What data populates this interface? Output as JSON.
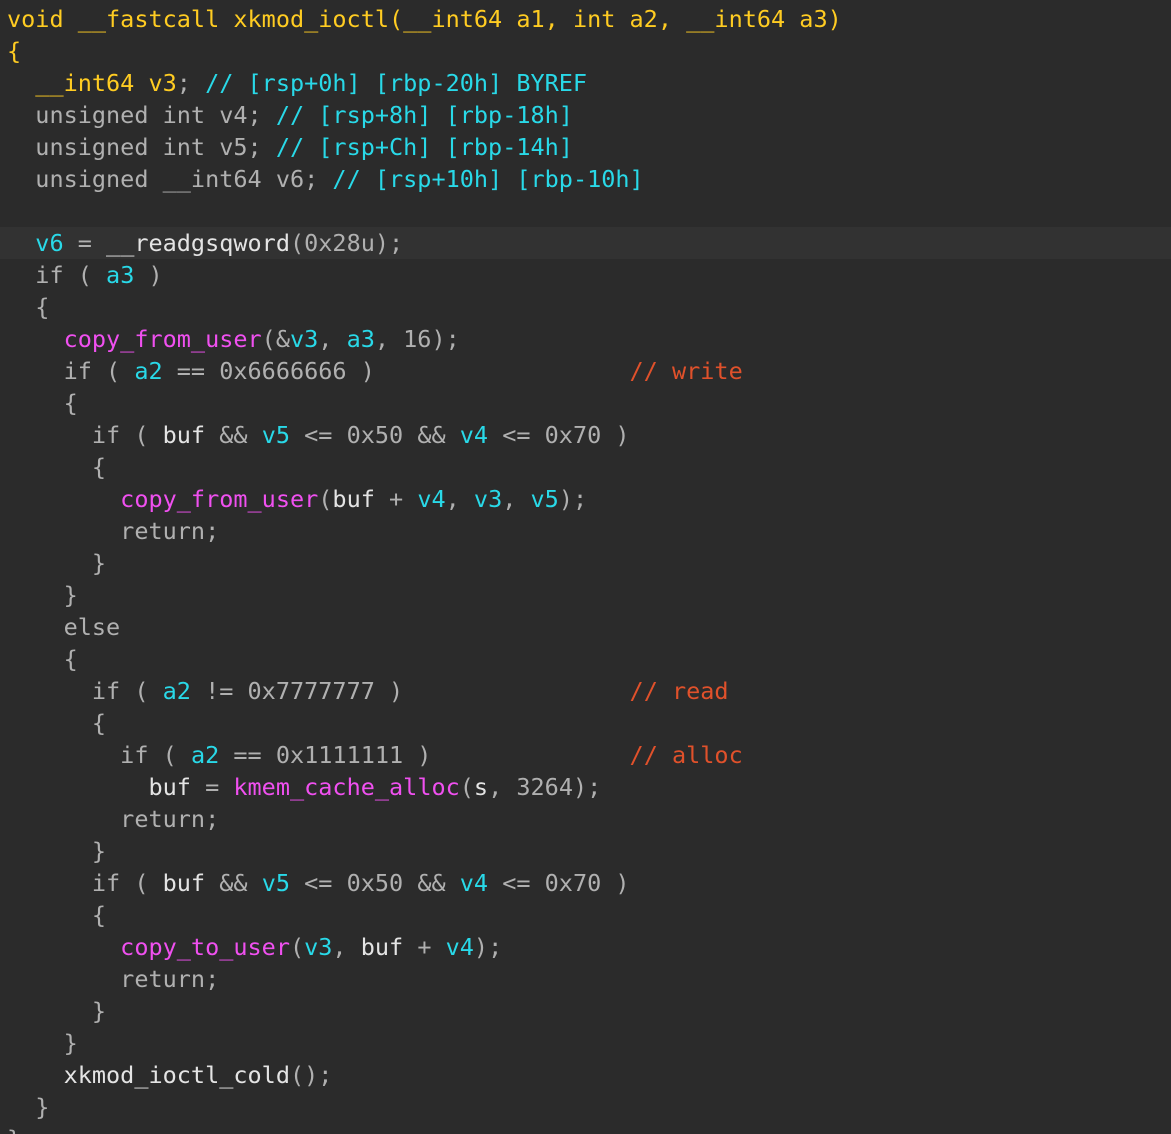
{
  "editor": {
    "highlighted_line": 8,
    "colors": {
      "background": "#2b2b2b",
      "current_line": "#323232",
      "keyword_yellow": "#ffcc22",
      "identifier_cyan": "#29d9e8",
      "plain_gray": "#b0b0b0",
      "global_white": "#e4e4e4",
      "function_magenta": "#f050f0",
      "comment_orange": "#e0512b"
    },
    "lines": [
      [
        [
          "t-yellow",
          "void __fastcall xkmod_ioctl("
        ],
        [
          "t-yellow",
          "__int64 a1"
        ],
        [
          "t-yellow",
          ", "
        ],
        [
          "t-yellow",
          "int a2"
        ],
        [
          "t-yellow",
          ", "
        ],
        [
          "t-yellow",
          "__int64 a3"
        ],
        [
          "t-yellow",
          ")"
        ]
      ],
      [
        [
          "t-yellow",
          "{"
        ]
      ],
      [
        [
          "t-yellow",
          "  __int64 v3"
        ],
        [
          "t-gray",
          "; "
        ],
        [
          "t-cyan",
          "// [rsp+0h] [rbp-20h] BYREF"
        ]
      ],
      [
        [
          "t-gray",
          "  unsigned int v4"
        ],
        [
          "t-gray",
          "; "
        ],
        [
          "t-cyan",
          "// [rsp+8h] [rbp-18h]"
        ]
      ],
      [
        [
          "t-gray",
          "  unsigned int v5"
        ],
        [
          "t-gray",
          "; "
        ],
        [
          "t-cyan",
          "// [rsp+Ch] [rbp-14h]"
        ]
      ],
      [
        [
          "t-gray",
          "  unsigned __int64 v6"
        ],
        [
          "t-gray",
          "; "
        ],
        [
          "t-cyan",
          "// [rsp+10h] [rbp-10h]"
        ]
      ],
      [
        [
          "t-gray",
          ""
        ]
      ],
      [
        [
          "t-cyan",
          "  v6"
        ],
        [
          "t-gray",
          " = "
        ],
        [
          "t-white",
          "__readgsqword"
        ],
        [
          "t-gray",
          "(0x28u);"
        ]
      ],
      [
        [
          "t-gray",
          "  if ( "
        ],
        [
          "t-cyan",
          "a3"
        ],
        [
          "t-gray",
          " )"
        ]
      ],
      [
        [
          "t-gray",
          "  {"
        ]
      ],
      [
        [
          "t-magenta",
          "    copy_from_user"
        ],
        [
          "t-gray",
          "(&"
        ],
        [
          "t-cyan",
          "v3"
        ],
        [
          "t-gray",
          ", "
        ],
        [
          "t-cyan",
          "a3"
        ],
        [
          "t-gray",
          ", 16);"
        ]
      ],
      [
        [
          "t-gray",
          "    if ( "
        ],
        [
          "t-cyan",
          "a2"
        ],
        [
          "t-gray",
          " == 0x6666666 )                  "
        ],
        [
          "t-comment",
          "// write"
        ]
      ],
      [
        [
          "t-gray",
          "    {"
        ]
      ],
      [
        [
          "t-gray",
          "      if ( "
        ],
        [
          "t-white",
          "buf"
        ],
        [
          "t-gray",
          " && "
        ],
        [
          "t-cyan",
          "v5"
        ],
        [
          "t-gray",
          " <= 0x50 && "
        ],
        [
          "t-cyan",
          "v4"
        ],
        [
          "t-gray",
          " <= 0x70 )"
        ]
      ],
      [
        [
          "t-gray",
          "      {"
        ]
      ],
      [
        [
          "t-magenta",
          "        copy_from_user"
        ],
        [
          "t-gray",
          "("
        ],
        [
          "t-white",
          "buf"
        ],
        [
          "t-gray",
          " + "
        ],
        [
          "t-cyan",
          "v4"
        ],
        [
          "t-gray",
          ", "
        ],
        [
          "t-cyan",
          "v3"
        ],
        [
          "t-gray",
          ", "
        ],
        [
          "t-cyan",
          "v5"
        ],
        [
          "t-gray",
          ");"
        ]
      ],
      [
        [
          "t-gray",
          "        return;"
        ]
      ],
      [
        [
          "t-gray",
          "      }"
        ]
      ],
      [
        [
          "t-gray",
          "    }"
        ]
      ],
      [
        [
          "t-gray",
          "    else"
        ]
      ],
      [
        [
          "t-gray",
          "    {"
        ]
      ],
      [
        [
          "t-gray",
          "      if ( "
        ],
        [
          "t-cyan",
          "a2"
        ],
        [
          "t-gray",
          " != 0x7777777 )                "
        ],
        [
          "t-comment",
          "// read"
        ]
      ],
      [
        [
          "t-gray",
          "      {"
        ]
      ],
      [
        [
          "t-gray",
          "        if ( "
        ],
        [
          "t-cyan",
          "a2"
        ],
        [
          "t-gray",
          " == 0x1111111 )              "
        ],
        [
          "t-comment",
          "// alloc"
        ]
      ],
      [
        [
          "t-white",
          "          buf"
        ],
        [
          "t-gray",
          " = "
        ],
        [
          "t-magenta",
          "kmem_cache_alloc"
        ],
        [
          "t-gray",
          "("
        ],
        [
          "t-white",
          "s"
        ],
        [
          "t-gray",
          ", 3264);"
        ]
      ],
      [
        [
          "t-gray",
          "        return;"
        ]
      ],
      [
        [
          "t-gray",
          "      }"
        ]
      ],
      [
        [
          "t-gray",
          "      if ( "
        ],
        [
          "t-white",
          "buf"
        ],
        [
          "t-gray",
          " && "
        ],
        [
          "t-cyan",
          "v5"
        ],
        [
          "t-gray",
          " <= 0x50 && "
        ],
        [
          "t-cyan",
          "v4"
        ],
        [
          "t-gray",
          " <= 0x70 )"
        ]
      ],
      [
        [
          "t-gray",
          "      {"
        ]
      ],
      [
        [
          "t-magenta",
          "        copy_to_user"
        ],
        [
          "t-gray",
          "("
        ],
        [
          "t-cyan",
          "v3"
        ],
        [
          "t-gray",
          ", "
        ],
        [
          "t-white",
          "buf"
        ],
        [
          "t-gray",
          " + "
        ],
        [
          "t-cyan",
          "v4"
        ],
        [
          "t-gray",
          ");"
        ]
      ],
      [
        [
          "t-gray",
          "        return;"
        ]
      ],
      [
        [
          "t-gray",
          "      }"
        ]
      ],
      [
        [
          "t-gray",
          "    }"
        ]
      ],
      [
        [
          "t-white",
          "    xkmod_ioctl_cold"
        ],
        [
          "t-gray",
          "();"
        ]
      ],
      [
        [
          "t-gray",
          "  }"
        ]
      ],
      [
        [
          "t-gray",
          "}"
        ]
      ]
    ]
  }
}
